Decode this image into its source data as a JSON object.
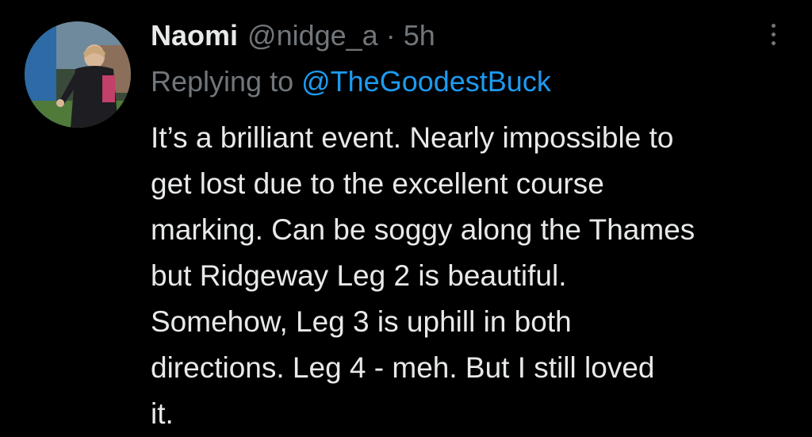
{
  "tweet": {
    "author": {
      "display_name": "Naomi",
      "handle": "@nidge_a",
      "separator": "·",
      "time": "5h",
      "avatar": "profile-photo"
    },
    "reply": {
      "prefix": "Replying to",
      "mention": "@TheGoodestBuck"
    },
    "text_lines": [
      "It’s a brilliant event. Nearly impossible to",
      "get lost due to the excellent course",
      "marking. Can be soggy along the Thames",
      "but Ridgeway Leg 2 is beautiful.",
      "Somehow, Leg 3 is uphill in both",
      "directions. Leg 4 - meh. But I still loved",
      "it."
    ],
    "menu_icon": "more-options-icon"
  },
  "colors": {
    "background": "#000000",
    "primary_text": "#e7e9ea",
    "secondary_text": "#71767b",
    "link": "#1d9bf0"
  }
}
